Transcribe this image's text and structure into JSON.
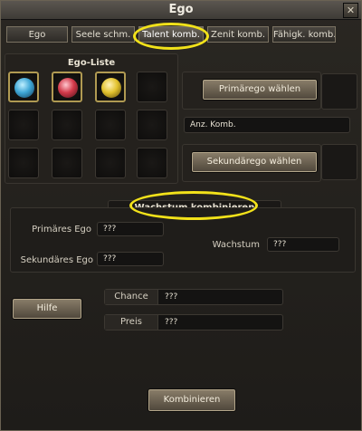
{
  "window": {
    "title": "Ego",
    "close_glyph": "✕"
  },
  "tabs": [
    {
      "label": "Ego",
      "active": false
    },
    {
      "label": "Seele schm.",
      "active": false
    },
    {
      "label": "Talent komb.",
      "active": true
    },
    {
      "label": "Zenit komb.",
      "active": false
    },
    {
      "label": "Fähigk. komb.",
      "active": false
    }
  ],
  "ego_list": {
    "title": "Ego-Liste",
    "slots": [
      {
        "icon": "blue-ego-orb-icon",
        "color": "#3fa7d6"
      },
      {
        "icon": "red-ego-orb-icon",
        "color": "#d23a4a"
      },
      {
        "icon": "yellow-ego-orb-icon",
        "color": "#e2c22e"
      }
    ]
  },
  "primary": {
    "button_label": "Primärego wählen"
  },
  "combination_count": {
    "label": "Anz. Komb."
  },
  "secondary": {
    "button_label": "Sekundärego wählen"
  },
  "growth": {
    "title": "Wachstum kombinieren",
    "primary_label": "Primäres Ego",
    "primary_value": "???",
    "secondary_label": "Sekundäres Ego",
    "secondary_value": "???",
    "growth_label": "Wachstum",
    "growth_value": "???"
  },
  "help_button": "Hilfe",
  "chance": {
    "label": "Chance",
    "value": "???"
  },
  "price": {
    "label": "Preis",
    "value": "???"
  },
  "combine_button": "Kombinieren",
  "colors": {
    "highlight": "#f2e21a",
    "button_border": "#b3a68a"
  }
}
